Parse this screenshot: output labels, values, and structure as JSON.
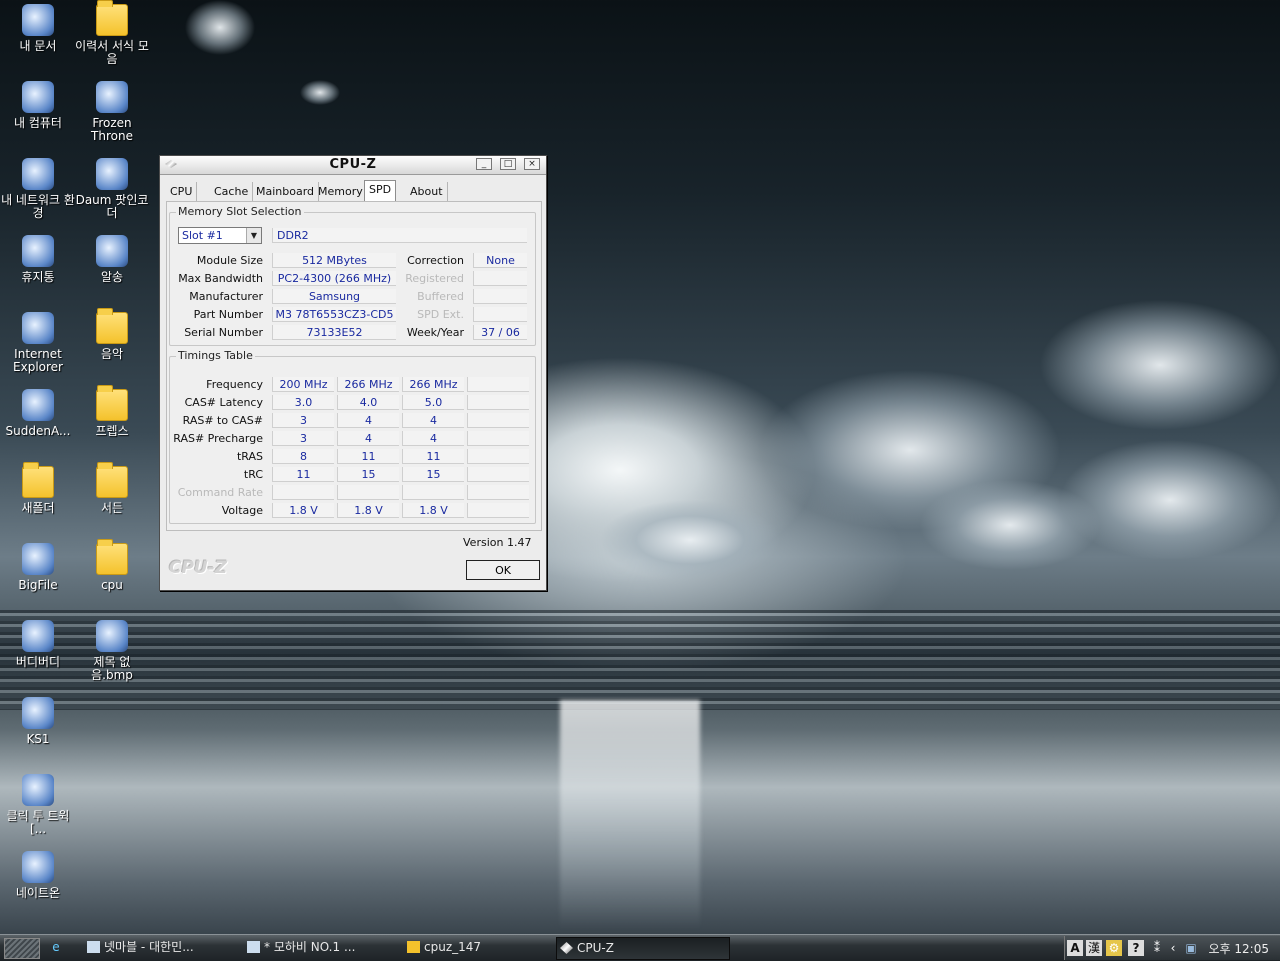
{
  "desktop_icons": [
    {
      "label": "내 문서",
      "icon": "my-documents-icon"
    },
    {
      "label": "이력서 서식 모음",
      "icon": "folder-icon"
    },
    {
      "label": "내 컴퓨터",
      "icon": "my-computer-icon"
    },
    {
      "label": "Frozen Throne",
      "icon": "game-shortcut-icon"
    },
    {
      "label": "내 네트워크 환경",
      "icon": "network-icon"
    },
    {
      "label": "Daum 팟인코더",
      "icon": "video-encoder-icon"
    },
    {
      "label": "휴지통",
      "icon": "recycle-bin-icon"
    },
    {
      "label": "알송",
      "icon": "alsong-icon"
    },
    {
      "label": "Internet Explorer",
      "icon": "internet-explorer-icon"
    },
    {
      "label": "음악",
      "icon": "folder-icon"
    },
    {
      "label": "SuddenA...",
      "icon": "sudden-attack-icon"
    },
    {
      "label": "프렙스",
      "icon": "folder-icon"
    },
    {
      "label": "새폴더",
      "icon": "folder-icon"
    },
    {
      "label": "서든",
      "icon": "folder-icon"
    },
    {
      "label": "BigFile",
      "icon": "bigfile-icon"
    },
    {
      "label": "cpu",
      "icon": "folder-icon"
    },
    {
      "label": "버디버디",
      "icon": "buddybuddy-icon"
    },
    {
      "label": "제목 없음.bmp",
      "icon": "bmp-file-icon"
    },
    {
      "label": "KS1",
      "icon": "ks1-icon"
    },
    {
      "label": "클릭 투 트윅 [...",
      "icon": "magnifier-icon"
    },
    {
      "label": "네이트온",
      "icon": "nateon-icon"
    }
  ],
  "window": {
    "title": "CPU-Z",
    "tabs": [
      "CPU",
      "Cache",
      "Mainboard",
      "Memory",
      "SPD",
      "About"
    ],
    "active_tab": "SPD",
    "slot_group_title": "Memory Slot Selection",
    "slot_selected": "Slot #1",
    "memory_type": "DDR2",
    "left_fields": [
      {
        "label": "Module Size",
        "value": "512 MBytes"
      },
      {
        "label": "Max Bandwidth",
        "value": "PC2-4300 (266 MHz)"
      },
      {
        "label": "Manufacturer",
        "value": "Samsung"
      },
      {
        "label": "Part Number",
        "value": "M3 78T6553CZ3-CD5"
      },
      {
        "label": "Serial Number",
        "value": "73133E52"
      }
    ],
    "right_fields": [
      {
        "label": "Correction",
        "value": "None",
        "disabled": false
      },
      {
        "label": "Registered",
        "value": "",
        "disabled": true
      },
      {
        "label": "Buffered",
        "value": "",
        "disabled": true
      },
      {
        "label": "SPD Ext.",
        "value": "",
        "disabled": true
      },
      {
        "label": "Week/Year",
        "value": "37 / 06",
        "disabled": false
      }
    ],
    "timings_title": "Timings Table",
    "timings": [
      {
        "label": "Frequency",
        "values": [
          "200 MHz",
          "266 MHz",
          "266 MHz",
          ""
        ]
      },
      {
        "label": "CAS# Latency",
        "values": [
          "3.0",
          "4.0",
          "5.0",
          ""
        ]
      },
      {
        "label": "RAS# to CAS#",
        "values": [
          "3",
          "4",
          "4",
          ""
        ]
      },
      {
        "label": "RAS# Precharge",
        "values": [
          "3",
          "4",
          "4",
          ""
        ]
      },
      {
        "label": "tRAS",
        "values": [
          "8",
          "11",
          "11",
          ""
        ]
      },
      {
        "label": "tRC",
        "values": [
          "11",
          "15",
          "15",
          ""
        ]
      },
      {
        "label": "Command Rate",
        "values": [
          "",
          "",
          "",
          ""
        ],
        "disabled": true
      },
      {
        "label": "Voltage",
        "values": [
          "1.8 V",
          "1.8 V",
          "1.8 V",
          ""
        ]
      }
    ],
    "version": "Version 1.47",
    "footer_logo": "CPU-Z",
    "ok_label": "OK",
    "minimize": "_",
    "maximize": "□",
    "close": "×"
  },
  "taskbar": {
    "items": [
      {
        "label": "넷마블 - 대한민...",
        "active": false
      },
      {
        "label": "* 모하비 NO.1 ...",
        "active": false
      },
      {
        "label": "cpuz_147",
        "active": false
      },
      {
        "label": "CPU-Z",
        "active": true
      }
    ],
    "tray": {
      "ime_a": "A",
      "ime_han": "漢",
      "clock": "오후 12:05"
    }
  }
}
